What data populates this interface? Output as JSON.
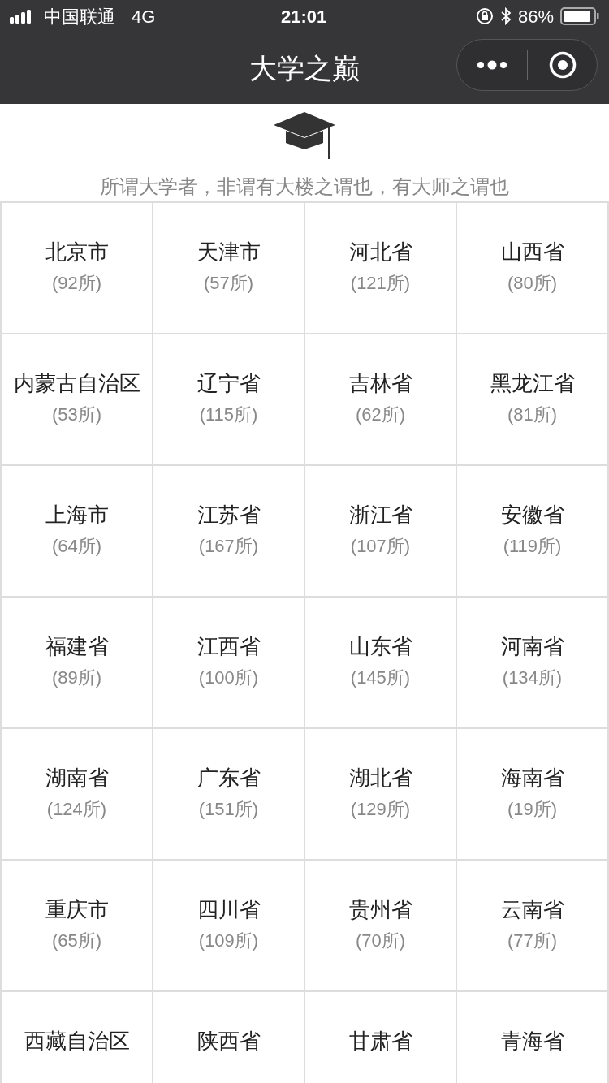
{
  "status_bar": {
    "carrier": "中国联通",
    "network": "4G",
    "time": "21:01",
    "battery": "86%"
  },
  "nav": {
    "title": "大学之巅"
  },
  "header": {
    "motto": "所谓大学者，非谓有大楼之谓也，有大师之谓也"
  },
  "regions": [
    {
      "name": "北京市",
      "count": "(92所)"
    },
    {
      "name": "天津市",
      "count": "(57所)"
    },
    {
      "name": "河北省",
      "count": "(121所)"
    },
    {
      "name": "山西省",
      "count": "(80所)"
    },
    {
      "name": "内蒙古自治区",
      "count": "(53所)"
    },
    {
      "name": "辽宁省",
      "count": "(115所)"
    },
    {
      "name": "吉林省",
      "count": "(62所)"
    },
    {
      "name": "黑龙江省",
      "count": "(81所)"
    },
    {
      "name": "上海市",
      "count": "(64所)"
    },
    {
      "name": "江苏省",
      "count": "(167所)"
    },
    {
      "name": "浙江省",
      "count": "(107所)"
    },
    {
      "name": "安徽省",
      "count": "(119所)"
    },
    {
      "name": "福建省",
      "count": "(89所)"
    },
    {
      "name": "江西省",
      "count": "(100所)"
    },
    {
      "name": "山东省",
      "count": "(145所)"
    },
    {
      "name": "河南省",
      "count": "(134所)"
    },
    {
      "name": "湖南省",
      "count": "(124所)"
    },
    {
      "name": "广东省",
      "count": "(151所)"
    },
    {
      "name": "湖北省",
      "count": "(129所)"
    },
    {
      "name": "海南省",
      "count": "(19所)"
    },
    {
      "name": "重庆市",
      "count": "(65所)"
    },
    {
      "name": "四川省",
      "count": "(109所)"
    },
    {
      "name": "贵州省",
      "count": "(70所)"
    },
    {
      "name": "云南省",
      "count": "(77所)"
    },
    {
      "name": "西藏自治区"
    },
    {
      "name": "陕西省"
    },
    {
      "name": "甘肃省"
    },
    {
      "name": "青海省"
    }
  ]
}
